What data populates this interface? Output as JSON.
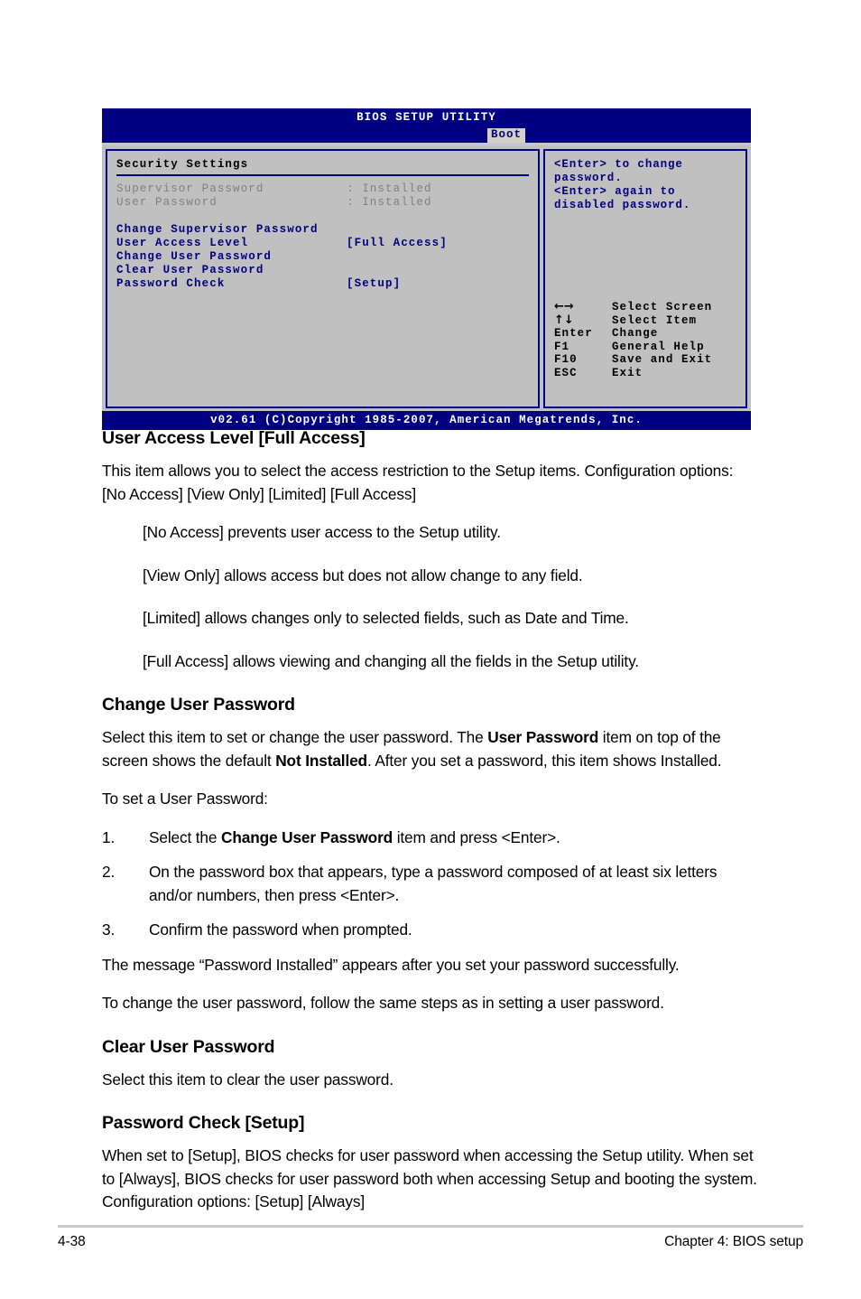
{
  "bios": {
    "title": "BIOS SETUP UTILITY",
    "tab": "Boot",
    "section_heading": "Security Settings",
    "status_rows": [
      {
        "label": "Supervisor Password",
        "sep": ": Installed"
      },
      {
        "label": "User Password",
        "sep": ": Installed"
      }
    ],
    "menu_rows": [
      {
        "label": "Change Supervisor Password",
        "value": ""
      },
      {
        "label": "User Access Level",
        "value": "[Full Access]"
      },
      {
        "label": "Change User Password",
        "value": ""
      },
      {
        "label": "Clear User Password",
        "value": ""
      },
      {
        "label": "Password Check",
        "value": "[Setup]"
      }
    ],
    "help": "<Enter> to change password.\n<Enter> again to disabled password.",
    "legend": [
      {
        "key": "←→",
        "val": "Select Screen"
      },
      {
        "key": "↑↓",
        "val": "Select Item"
      },
      {
        "key": "Enter",
        "val": "Change"
      },
      {
        "key": "F1",
        "val": "General Help"
      },
      {
        "key": "F10",
        "val": "Save and Exit"
      },
      {
        "key": "ESC",
        "val": "Exit"
      }
    ],
    "copyright": "v02.61 (C)Copyright 1985-2007, American Megatrends, Inc.",
    "colors": {
      "chrome_blue": "#000080",
      "panel_gray": "#c0c0c0",
      "dim_text": "#808080"
    }
  },
  "doc": {
    "h_user_access": "User Access Level [Full Access]",
    "p_user_access_1": "This item allows you to select the access restriction to the Setup items. Configuration options: [No Access] [View Only] [Limited] [Full Access]",
    "p_no_access": "[No Access] prevents user access to the Setup utility.",
    "p_view_only": "[View Only] allows access but does not allow change to any field.",
    "p_limited": "[Limited] allows changes only to selected fields, such as Date and Time.",
    "p_full_access": "[Full Access] allows viewing and changing all the fields in the Setup utility.",
    "h_change_user_pw": "Change User Password",
    "p_change_1a": "Select this item to set or change the user password. The ",
    "p_change_1b": "User Password",
    "p_change_1c": " item on top of the screen shows the default ",
    "p_change_1d": "Not Installed",
    "p_change_1e": ". After you set a password, this item shows Installed.",
    "p_to_set": "To set a User Password:",
    "steps": [
      {
        "num": "1.",
        "a": "Select the ",
        "b": "Change User Password",
        "c": " item and press <Enter>."
      },
      {
        "num": "2.",
        "a": "On the password box that appears, type a password composed of at least six letters and/or numbers, then press <Enter>.",
        "b": "",
        "c": ""
      },
      {
        "num": "3.",
        "a": "Confirm the password when prompted.",
        "b": "",
        "c": ""
      }
    ],
    "p_message": "The message “Password Installed” appears after you set your password successfully.",
    "p_to_change": "To change the user password, follow the same steps as in setting a user password.",
    "h_clear_user_pw": "Clear User Password",
    "p_clear": "Select this item to clear the user password.",
    "h_password_check": "Password Check [Setup]",
    "p_password_check": "When set to [Setup], BIOS checks for user password when accessing the Setup utility. When set to [Always], BIOS checks for user password both when accessing Setup and booting the system. Configuration options: [Setup] [Always]"
  },
  "page": {
    "number": "4-38",
    "chapter": "Chapter 4: BIOS setup"
  }
}
